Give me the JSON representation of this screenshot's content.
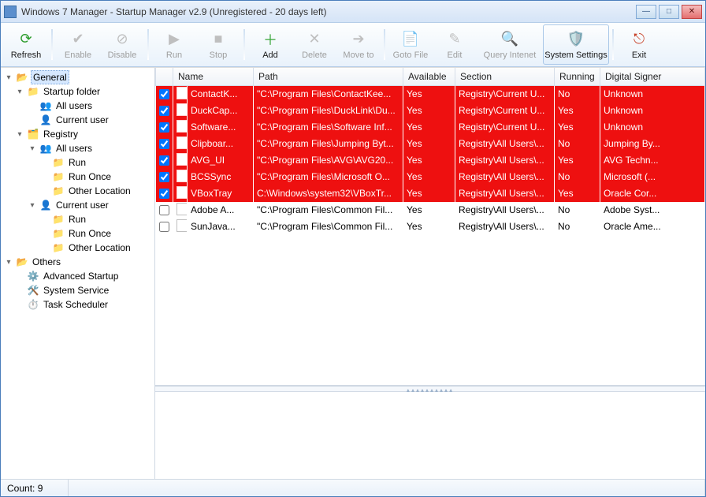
{
  "title": "Windows 7 Manager - Startup Manager v2.9 (Unregistered - 20 days left)",
  "toolbar": {
    "refresh": "Refresh",
    "enable": "Enable",
    "disable": "Disable",
    "run": "Run",
    "stop": "Stop",
    "add": "Add",
    "delete": "Delete",
    "moveto": "Move to",
    "gotofile": "Goto File",
    "edit": "Edit",
    "query": "Query Intenet",
    "settings": "System Settings",
    "exit": "Exit"
  },
  "tree": {
    "g0": "General",
    "g1": "Startup folder",
    "g1a": "All users",
    "g1b": "Current user",
    "g2": "Registry",
    "g2a": "All users",
    "g2a1": "Run",
    "g2a2": "Run Once",
    "g2a3": "Other Location",
    "g2b": "Current user",
    "g2b1": "Run",
    "g2b2": "Run Once",
    "g2b3": "Other Location",
    "o0": "Others",
    "o1": "Advanced Startup",
    "o2": "System Service",
    "o3": "Task Scheduler"
  },
  "columns": {
    "name": "Name",
    "path": "Path",
    "available": "Available",
    "section": "Section",
    "running": "Running",
    "signer": "Digital Signer"
  },
  "rows": [
    {
      "chk": true,
      "red": true,
      "name": "ContactK...",
      "path": "\"C:\\Program Files\\ContactKee...",
      "available": "Yes",
      "section": "Registry\\Current U...",
      "running": "No",
      "signer": "Unknown"
    },
    {
      "chk": true,
      "red": true,
      "name": "DuckCap...",
      "path": "\"C:\\Program Files\\DuckLink\\Du...",
      "available": "Yes",
      "section": "Registry\\Current U...",
      "running": "Yes",
      "signer": "Unknown"
    },
    {
      "chk": true,
      "red": true,
      "name": "Software...",
      "path": "\"C:\\Program Files\\Software Inf...",
      "available": "Yes",
      "section": "Registry\\Current U...",
      "running": "Yes",
      "signer": "Unknown"
    },
    {
      "chk": true,
      "red": true,
      "name": "Clipboar...",
      "path": "\"C:\\Program Files\\Jumping Byt...",
      "available": "Yes",
      "section": "Registry\\All Users\\...",
      "running": "No",
      "signer": "Jumping By..."
    },
    {
      "chk": true,
      "red": true,
      "name": "AVG_UI",
      "path": "\"C:\\Program Files\\AVG\\AVG20...",
      "available": "Yes",
      "section": "Registry\\All Users\\...",
      "running": "Yes",
      "signer": "AVG Techn..."
    },
    {
      "chk": true,
      "red": true,
      "name": "BCSSync",
      "path": "\"C:\\Program Files\\Microsoft O...",
      "available": "Yes",
      "section": "Registry\\All Users\\...",
      "running": "No",
      "signer": "Microsoft (..."
    },
    {
      "chk": true,
      "red": true,
      "name": "VBoxTray",
      "path": "C:\\Windows\\system32\\VBoxTr...",
      "available": "Yes",
      "section": "Registry\\All Users\\...",
      "running": "Yes",
      "signer": "Oracle Cor..."
    },
    {
      "chk": false,
      "red": false,
      "name": "Adobe A...",
      "path": "\"C:\\Program Files\\Common Fil...",
      "available": "Yes",
      "section": "Registry\\All Users\\...",
      "running": "No",
      "signer": "Adobe Syst..."
    },
    {
      "chk": false,
      "red": false,
      "name": "SunJava...",
      "path": "\"C:\\Program Files\\Common Fil...",
      "available": "Yes",
      "section": "Registry\\All Users\\...",
      "running": "No",
      "signer": "Oracle Ame..."
    }
  ],
  "status": {
    "count": "Count: 9"
  }
}
